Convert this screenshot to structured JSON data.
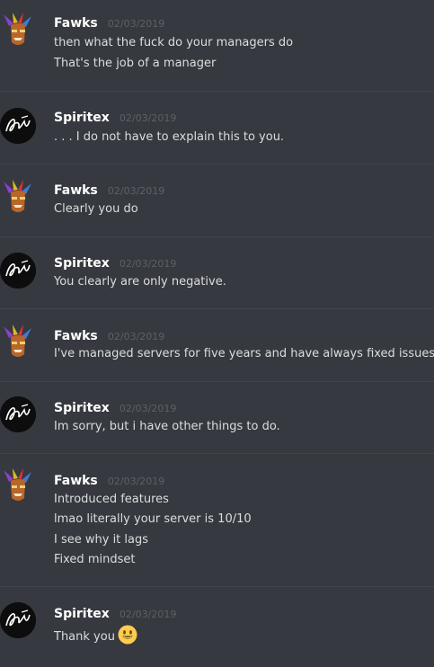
{
  "messages": [
    {
      "author": "Fawks",
      "timestamp": "02/03/2019",
      "avatar": "crash-mask-icon",
      "lines": [
        "then what the fuck do your managers do",
        "That's the job of a manager"
      ]
    },
    {
      "author": "Spiritex",
      "timestamp": "02/03/2019",
      "avatar": "spiritex-logo-icon",
      "lines": [
        ". . . I do not have to explain this to you."
      ]
    },
    {
      "author": "Fawks",
      "timestamp": "02/03/2019",
      "avatar": "crash-mask-icon",
      "lines": [
        "Clearly you do"
      ]
    },
    {
      "author": "Spiritex",
      "timestamp": "02/03/2019",
      "avatar": "spiritex-logo-icon",
      "lines": [
        "You clearly are only negative."
      ]
    },
    {
      "author": "Fawks",
      "timestamp": "02/03/2019",
      "avatar": "crash-mask-icon",
      "lines": [
        "I've managed servers for five years and have always fixed issues"
      ]
    },
    {
      "author": "Spiritex",
      "timestamp": "02/03/2019",
      "avatar": "spiritex-logo-icon",
      "lines": [
        "Im sorry, but i have other things to do."
      ]
    },
    {
      "author": "Fawks",
      "timestamp": "02/03/2019",
      "avatar": "crash-mask-icon",
      "lines": [
        "Introduced features",
        "lmao literally your server is 10/10",
        "I see why it lags",
        "Fixed mindset"
      ]
    },
    {
      "author": "Spiritex",
      "timestamp": "02/03/2019",
      "avatar": "spiritex-logo-icon",
      "lines": [
        "Thank you"
      ],
      "trailing_emoji": "grinning-face-emoji"
    }
  ],
  "colors": {
    "background": "#36393f",
    "divider": "#40444b",
    "username": "#ffffff",
    "timestamp": "#5e6066",
    "message_text": "#dcddde"
  }
}
